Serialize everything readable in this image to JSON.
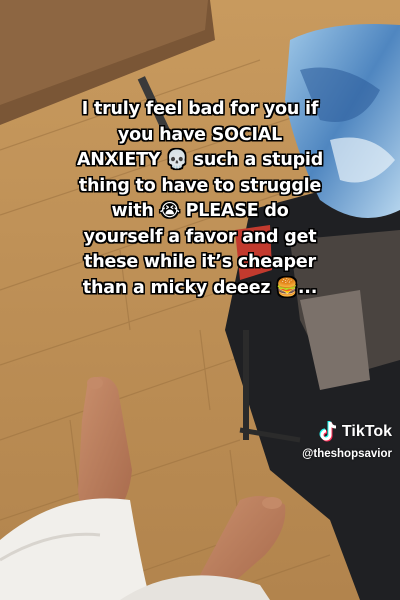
{
  "caption": {
    "lines": [
      "I truly feel bad for you if",
      "you have SOCIAL",
      "ANXIETY 💀 such a stupid",
      "thing to have to struggle",
      "with 😭 PLEASE do",
      "yourself a favor and get",
      "these while it’s cheaper",
      "than a micky deeez 🍔..."
    ]
  },
  "watermark": {
    "brand": "TikTok",
    "handle": "@theshopsavior",
    "icon": "tiktok-logo-icon"
  },
  "colors": {
    "caption_text": "#ffffff",
    "caption_outline": "#000000",
    "floor": "#b98e57",
    "table": "#7a5a3a",
    "blanket": "#6fa6d0"
  }
}
